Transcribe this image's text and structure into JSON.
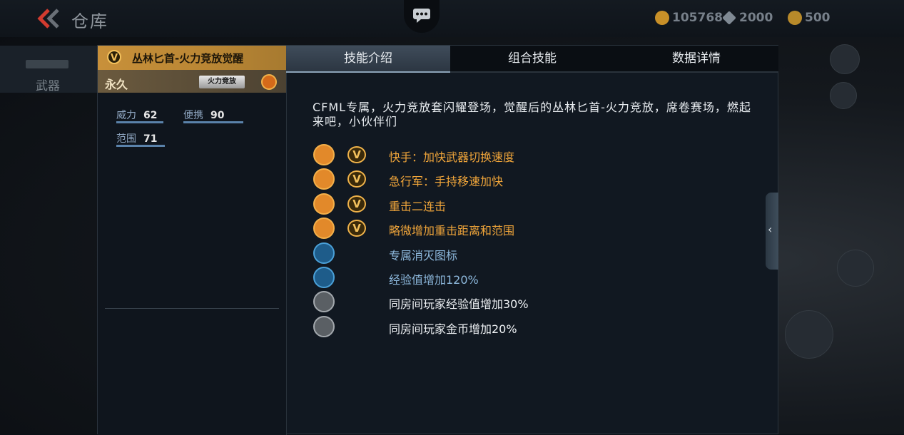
{
  "topbar": {
    "title": "仓库",
    "currencies": [
      {
        "name": "coin-icon",
        "value": "105768",
        "color": "#d29a2e"
      },
      {
        "name": "diamond-icon",
        "value": "2000",
        "color": "#8b97a3"
      },
      {
        "name": "gold-icon",
        "value": "500",
        "color": "#c89a30"
      }
    ]
  },
  "left_nav": {
    "weapon_tab": "武器"
  },
  "weapon": {
    "name": "丛林匕首-火力竞放觉醒",
    "rank_badge": "V",
    "duration": "永久",
    "skin_tag": "火力竞放",
    "stats": [
      {
        "label": "威力",
        "value": "62"
      },
      {
        "label": "便携",
        "value": "90"
      },
      {
        "label": "范围",
        "value": "71"
      }
    ]
  },
  "tabs": [
    {
      "label": "技能介绍",
      "active": true
    },
    {
      "label": "组合技能",
      "active": false
    },
    {
      "label": "数据详情",
      "active": false
    }
  ],
  "description": "CFML专属，火力竞放套闪耀登场，觉醒后的丛林匕首-火力竞放，席卷赛场，燃起来吧，小伙伴们",
  "skills": [
    {
      "icon": "quick-swap-icon",
      "tier": "gold",
      "rank": "V",
      "text": "快手：加快武器切换速度"
    },
    {
      "icon": "sprint-icon",
      "tier": "gold",
      "rank": "V",
      "text": "急行军：手持移速加快"
    },
    {
      "icon": "double-strike-icon",
      "tier": "gold",
      "rank": "V",
      "text": "重击二连击"
    },
    {
      "icon": "range-icon",
      "tier": "gold",
      "rank": "V",
      "text": "略微增加重击距离和范围"
    },
    {
      "icon": "kill-icon",
      "tier": "blue",
      "rank": "",
      "text": "专属消灭图标"
    },
    {
      "icon": "exp-icon",
      "tier": "blue",
      "rank": "",
      "text": "经验值增加120%"
    },
    {
      "icon": "room-exp-icon",
      "tier": "gray",
      "rank": "",
      "text": "同房间玩家经验值增加30%"
    },
    {
      "icon": "room-gold-icon",
      "tier": "gray",
      "rank": "",
      "text": "同房间玩家金币增加20%"
    }
  ]
}
